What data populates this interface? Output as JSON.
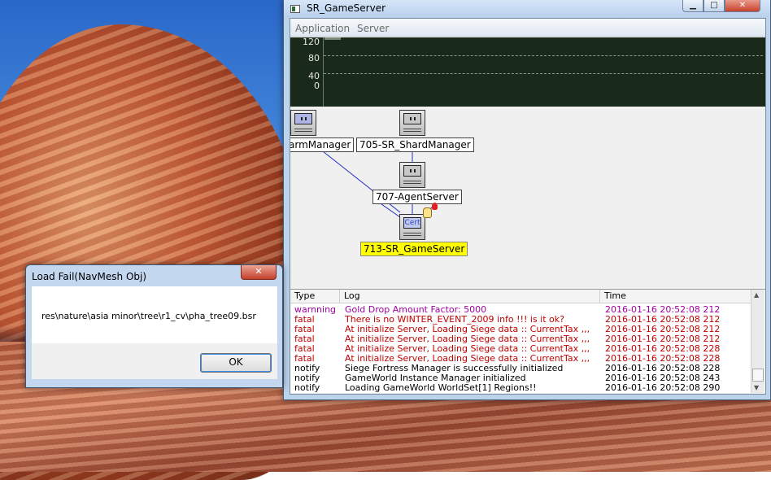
{
  "window": {
    "title": "SR_GameServer",
    "controls": {
      "minimize": "▁",
      "maximize": "□",
      "close": "✕"
    }
  },
  "menu": [
    "Application",
    "Server"
  ],
  "graph": {
    "y_ticks": [
      "120",
      "80",
      "40",
      "0"
    ]
  },
  "nodes": {
    "farm_manager": "armManager",
    "shard_manager": "705-SR_ShardManager",
    "agent_server": "707-AgentServer",
    "game_server": "713-SR_GameServer",
    "cert_label": "Cert"
  },
  "log": {
    "columns": [
      "Type",
      "Log",
      "Time"
    ],
    "rows": [
      {
        "type": "warnning",
        "log": "Gold Drop Amount Factor: 5000",
        "time": "2016-01-16 20:52:08 212",
        "color": "#a000a0"
      },
      {
        "type": "fatal",
        "log": "There is no WINTER_EVENT_2009 info !!! is it ok?",
        "time": "2016-01-16 20:52:08 212",
        "color": "#c00000"
      },
      {
        "type": "fatal",
        "log": "At initialize Server, Loading Siege data :: CurrentTax ,,,",
        "time": "2016-01-16 20:52:08 212",
        "color": "#c00000"
      },
      {
        "type": "fatal",
        "log": "At initialize Server, Loading Siege data :: CurrentTax ,,,",
        "time": "2016-01-16 20:52:08 212",
        "color": "#c00000"
      },
      {
        "type": "fatal",
        "log": "At initialize Server, Loading Siege data :: CurrentTax ,,,",
        "time": "2016-01-16 20:52:08 228",
        "color": "#c00000"
      },
      {
        "type": "fatal",
        "log": "At initialize Server, Loading Siege data :: CurrentTax ,,,",
        "time": "2016-01-16 20:52:08 228",
        "color": "#c00000"
      },
      {
        "type": "notify",
        "log": "Siege Fortress Manager is successfully initialized",
        "time": "2016-01-16 20:52:08 228",
        "color": "#000000"
      },
      {
        "type": "notify",
        "log": "GameWorld Instance Manager initialized",
        "time": "2016-01-16 20:52:08 243",
        "color": "#000000"
      },
      {
        "type": "notify",
        "log": "Loading GameWorld WorldSet[1] Regions!!",
        "time": "2016-01-16 20:52:08 290",
        "color": "#000000"
      }
    ]
  },
  "dialog": {
    "title": "Load Fail(NavMesh Obj)",
    "message": "res\\nature\\asia minor\\tree\\r1_cv\\pha_tree09.bsr",
    "ok_label": "OK",
    "close_label": "✕"
  }
}
